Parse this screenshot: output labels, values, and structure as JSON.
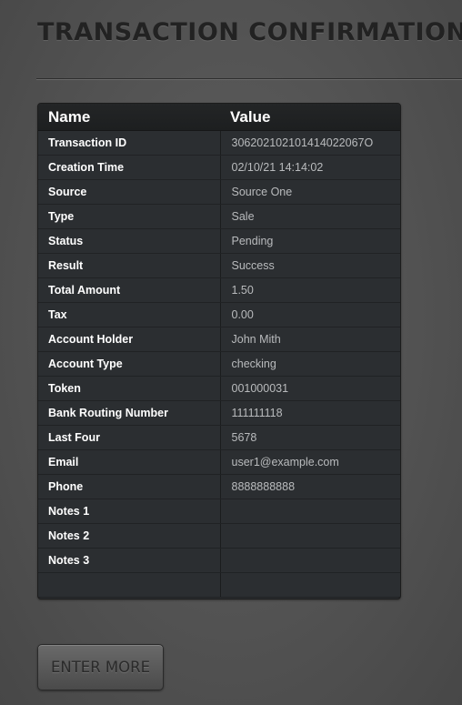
{
  "page": {
    "title": "TRANSACTION CONFIRMATION"
  },
  "table": {
    "headers": {
      "name": "Name",
      "value": "Value"
    },
    "rows": [
      {
        "name": "Transaction ID",
        "value": "306202102101414022067O"
      },
      {
        "name": "Creation Time",
        "value": "02/10/21 14:14:02"
      },
      {
        "name": "Source",
        "value": "Source One"
      },
      {
        "name": "Type",
        "value": "Sale"
      },
      {
        "name": "Status",
        "value": "Pending"
      },
      {
        "name": "Result",
        "value": "Success"
      },
      {
        "name": "Total Amount",
        "value": "1.50"
      },
      {
        "name": "Tax",
        "value": "0.00"
      },
      {
        "name": "Account Holder",
        "value": "John Mith"
      },
      {
        "name": "Account Type",
        "value": "checking"
      },
      {
        "name": "Token",
        "value": "001000031"
      },
      {
        "name": "Bank Routing Number",
        "value": "111111118"
      },
      {
        "name": "Last Four",
        "value": "5678"
      },
      {
        "name": "Email",
        "value": "user1@example.com"
      },
      {
        "name": "Phone",
        "value": "8888888888"
      },
      {
        "name": "Notes 1",
        "value": ""
      },
      {
        "name": "Notes 2",
        "value": ""
      },
      {
        "name": "Notes 3",
        "value": ""
      }
    ]
  },
  "actions": {
    "enter_more_label": "ENTER MORE"
  }
}
